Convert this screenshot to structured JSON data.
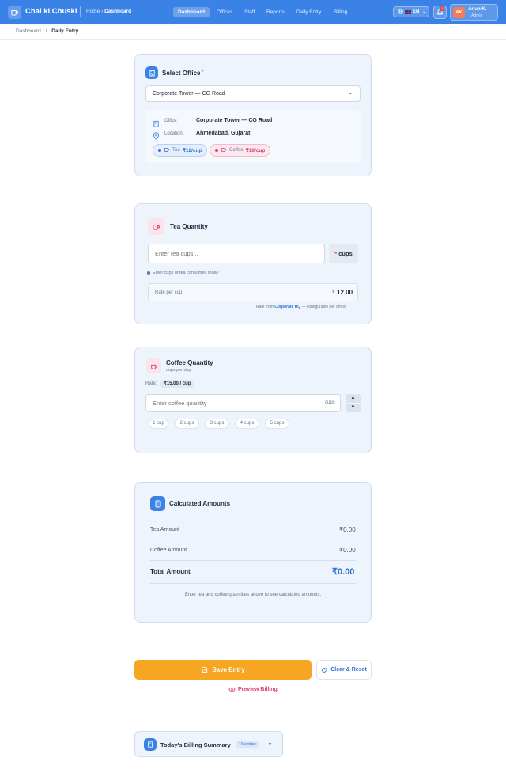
{
  "app": {
    "brand": "Chai ki Chuski"
  },
  "header": {
    "crumb_home": "Home",
    "crumb_sep": "›",
    "crumb_current": "Dashboard",
    "nav": [
      {
        "label": "Dashboard",
        "active": true
      },
      {
        "label": "Offices"
      },
      {
        "label": "Staff"
      },
      {
        "label": "Reports"
      },
      {
        "label": "Daily Entry"
      },
      {
        "label": "Billing"
      }
    ],
    "language": "EN",
    "notification_count": "3",
    "user_initials": "AK",
    "user_name": "Arjun K.",
    "user_role": "Admin"
  },
  "breadcrumb": {
    "parent": "Dashboard",
    "sep": "/",
    "current": "Daily Entry"
  },
  "office_card": {
    "title": "Select Office",
    "required_mark": "*",
    "selected": "Corporate Tower — CG Road",
    "office_label": "Office",
    "office_value": "Corporate Tower — CG Road",
    "location_label": "Location",
    "location_value": "Ahmedabad, Gujarat",
    "tea_label": "Tea",
    "tea_rate": "₹12/cup",
    "coffee_label": "Coffee",
    "coffee_rate": "₹18/cup"
  },
  "tea_card": {
    "title": "Tea Quantity",
    "placeholder": "Enter tea cups...",
    "unit_mark": "*",
    "unit": "cups",
    "hint": "Enter cups of tea consumed today",
    "rate_label": "Rate per cup",
    "rate_currency": "₹",
    "rate_value": "12.00",
    "rate_note_prefix": "Rate from",
    "rate_note_office": "Corporate HQ",
    "rate_note_suffix": "— configurable per office"
  },
  "coffee_card": {
    "title": "Coffee Quantity",
    "subtitle": "cups per day",
    "rate_label": "Rate:",
    "rate_value": "₹15.00 / cup",
    "placeholder": "Enter coffee quantity",
    "unit": "cups",
    "quick": [
      "1 cup",
      "2 cups",
      "3 cups",
      "4 cups",
      "5 cups"
    ]
  },
  "calc_card": {
    "title": "Calculated Amounts",
    "tea_label": "Tea Amount",
    "tea_value": "₹0.00",
    "coffee_label": "Coffee Amount",
    "coffee_value": "₹0.00",
    "total_label": "Total Amount",
    "total_value": "₹0.00",
    "note": "Enter tea and coffee quantities above to see calculated amounts."
  },
  "actions": {
    "save": "Save Entry",
    "clear": "Clear & Reset",
    "preview": "Preview Billing"
  },
  "summary": {
    "title": "Today's Billing Summary",
    "badge": "10 entries"
  },
  "colors": {
    "primary": "#3b82e6",
    "accent": "#f6a623",
    "tea": "#2f6fd6",
    "coffee": "#dc3d6e"
  }
}
